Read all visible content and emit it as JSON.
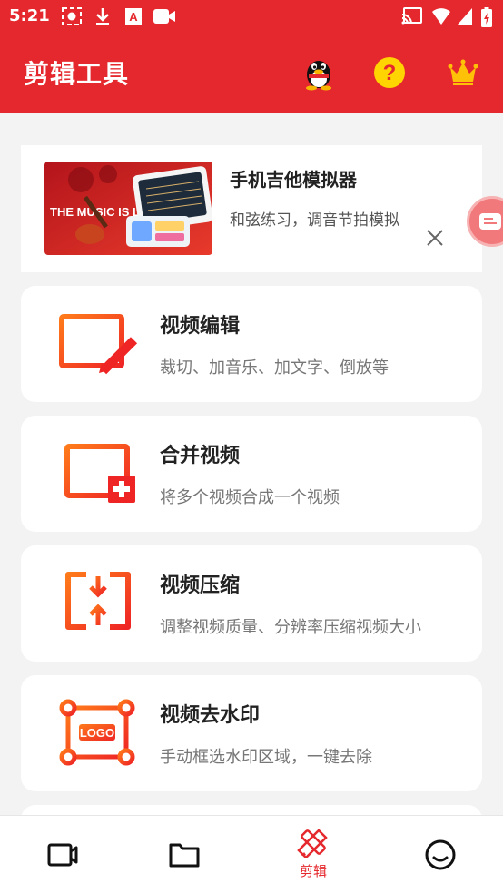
{
  "status_bar": {
    "time": "5:21",
    "left_icons": [
      "screen-record-icon",
      "download-icon",
      "a-notification-icon",
      "video-camera-icon"
    ],
    "right_icons": [
      "cast-icon",
      "wifi-icon",
      "signal-icon",
      "battery-icon"
    ]
  },
  "app_bar": {
    "title": "剪辑工具",
    "actions": [
      "qq-penguin-icon",
      "help-icon",
      "vip-crown-icon"
    ]
  },
  "ad": {
    "title": "手机吉他模拟器",
    "description": "和弦练习，调音节拍模拟",
    "thumbnail_text": "THE MUSIC IS LIVE"
  },
  "tools": [
    {
      "title": "视频编辑",
      "description": "裁切、加音乐、加文字、倒放等",
      "icon": "video-edit-icon"
    },
    {
      "title": "合并视频",
      "description": "将多个视频合成一个视频",
      "icon": "video-merge-icon"
    },
    {
      "title": "视频压缩",
      "description": "调整视频质量、分辨率压缩视频大小",
      "icon": "video-compress-icon"
    },
    {
      "title": "视频去水印",
      "description": "手动框选水印区域，一键去除",
      "icon": "watermark-remove-icon"
    }
  ],
  "watermark_icon_text": "LOGO",
  "tab_bar": {
    "tabs": [
      {
        "label": "",
        "icon": "video-camera-tab-icon"
      },
      {
        "label": "",
        "icon": "folder-tab-icon"
      },
      {
        "label": "剪辑",
        "icon": "edit-tools-tab-icon",
        "active": true
      },
      {
        "label": "",
        "icon": "smiley-tab-icon"
      }
    ]
  },
  "colors": {
    "primary": "#e5282d",
    "accent_orange": "#ff5a1f",
    "gold": "#ffc107"
  }
}
